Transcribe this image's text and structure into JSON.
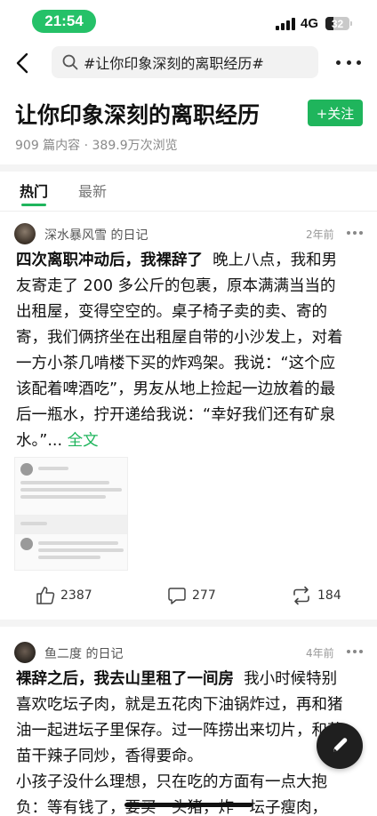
{
  "status_bar": {
    "time": "21:54",
    "network": "4G",
    "battery": "32",
    "battery_level": 0.32
  },
  "search": {
    "query": "#让你印象深刻的离职经历#",
    "icon": "search-icon"
  },
  "topic": {
    "title": "让你印象深刻的离职经历",
    "follow_label": "+关注",
    "stats": "909 篇内容 · 389.9万次浏览"
  },
  "tabs": [
    {
      "label": "热门",
      "active": true
    },
    {
      "label": "最新",
      "active": false
    }
  ],
  "posts": [
    {
      "author": "深水暴风雪 的日记",
      "time": "2年前",
      "title": "四次离职冲动后，我裸辞了",
      "body": "晚上八点，我和男友寄走了 200 多公斤的包裹，原本满满当当的出租屋，变得空空的。桌子椅子卖的卖、寄的寄，我们俩挤坐在出租屋自带的小沙发上，对着一方小茶几啃楼下买的炸鸡架。我说：“这个应该配着啤酒吃”，男友从地上捡起一边放着的最后一瓶水，拧开递给我说：“幸好我们还有矿泉水。”...",
      "more_label": "全文",
      "likes": "2387",
      "comments": "277",
      "reposts": "184"
    },
    {
      "author": "鱼二度 的日记",
      "time": "4年前",
      "title": "裸辞之后，我去山里租了一间房",
      "body": "我小时候特别喜欢吃坛子肉，就是五花肉下油锅炸过，再和猪油一起进坛子里保存。过一阵捞出来切片，和蒜苗干辣子同炒，香得要命。",
      "body2": "小孩子没什么理想，只在吃的方面有一点大抱负：等有钱了，要买一头猪，炸一坛子瘦肉，"
    }
  ],
  "colors": {
    "accent": "#1fb55c",
    "time_pill": "#25c168"
  }
}
